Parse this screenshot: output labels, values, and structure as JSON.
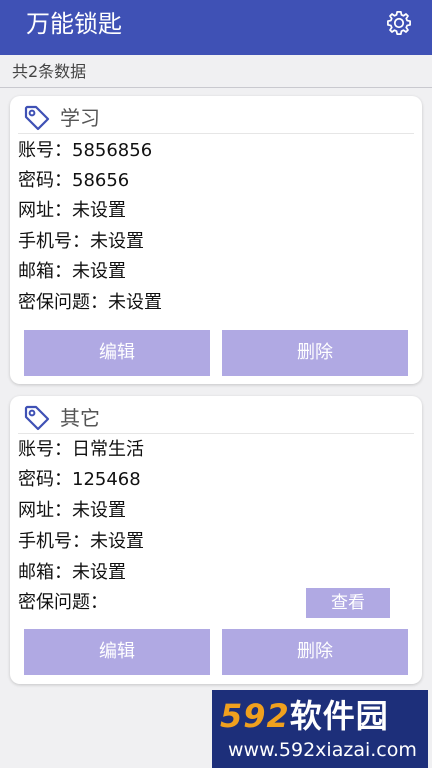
{
  "app": {
    "title": "万能锁匙",
    "settings_icon": "gear-icon",
    "bar_color": "#3f51b5"
  },
  "list": {
    "count_text": "共2条数据"
  },
  "entries": [
    {
      "category": "学习",
      "fields": [
        {
          "label": "账号：",
          "value": "5856856"
        },
        {
          "label": "密码：",
          "value": "58656"
        },
        {
          "label": "网址：",
          "value": "未设置"
        },
        {
          "label": "手机号：",
          "value": "未设置"
        },
        {
          "label": "邮箱：",
          "value": "未设置"
        },
        {
          "label": "密保问题：",
          "value": "未设置"
        }
      ],
      "edit_label": "编辑",
      "delete_label": "删除"
    },
    {
      "category": "其它",
      "fields": [
        {
          "label": "账号：",
          "value": "日常生活"
        },
        {
          "label": "密码：",
          "value": "125468"
        },
        {
          "label": "网址：",
          "value": "未设置"
        },
        {
          "label": "手机号：",
          "value": "未设置"
        },
        {
          "label": "邮箱：",
          "value": "未设置"
        },
        {
          "label": "密保问题：",
          "value": ""
        }
      ],
      "view_label": "查看",
      "edit_label": "编辑",
      "delete_label": "删除"
    }
  ],
  "watermark": {
    "brand_num": "592",
    "brand_text": "软件园",
    "url": "www.592xiazai.com"
  },
  "colors": {
    "button": "#b0a9e3",
    "accent": "#3f51b5"
  }
}
